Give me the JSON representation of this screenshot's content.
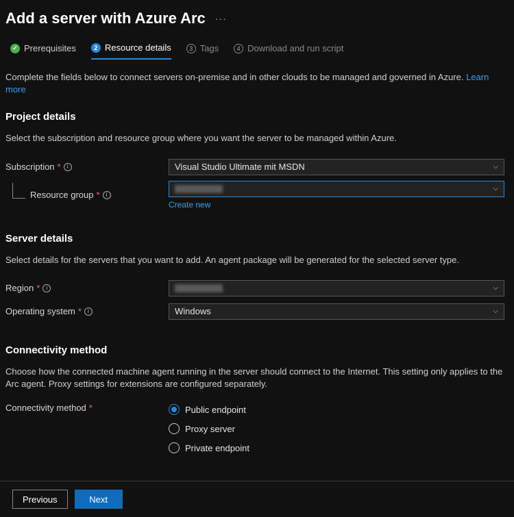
{
  "header": {
    "title": "Add a server with Azure Arc"
  },
  "tabs": [
    {
      "label": "Prerequisites",
      "state": "done"
    },
    {
      "label": "Resource details",
      "state": "active",
      "num": "2"
    },
    {
      "label": "Tags",
      "state": "pending",
      "num": "3"
    },
    {
      "label": "Download and run script",
      "state": "pending",
      "num": "4"
    }
  ],
  "intro": {
    "text": "Complete the fields below to connect servers on-premise and in other clouds to be managed and governed in Azure. ",
    "link": "Learn more"
  },
  "project": {
    "title": "Project details",
    "desc": "Select the subscription and resource group where you want the server to be managed within Azure.",
    "subscription_label": "Subscription",
    "subscription_value": "Visual Studio Ultimate mit MSDN",
    "resource_group_label": "Resource group",
    "resource_group_value": "",
    "create_new": "Create new"
  },
  "server": {
    "title": "Server details",
    "desc": "Select details for the servers that you want to add. An agent package will be generated for the selected server type.",
    "region_label": "Region",
    "region_value": "",
    "os_label": "Operating system",
    "os_value": "Windows"
  },
  "connectivity": {
    "title": "Connectivity method",
    "desc": "Choose how the connected machine agent running in the server should connect to the Internet. This setting only applies to the Arc agent. Proxy settings for extensions are configured separately.",
    "label": "Connectivity method",
    "options": [
      {
        "label": "Public endpoint",
        "selected": true
      },
      {
        "label": "Proxy server",
        "selected": false
      },
      {
        "label": "Private endpoint",
        "selected": false
      }
    ]
  },
  "footer": {
    "previous": "Previous",
    "next": "Next"
  }
}
